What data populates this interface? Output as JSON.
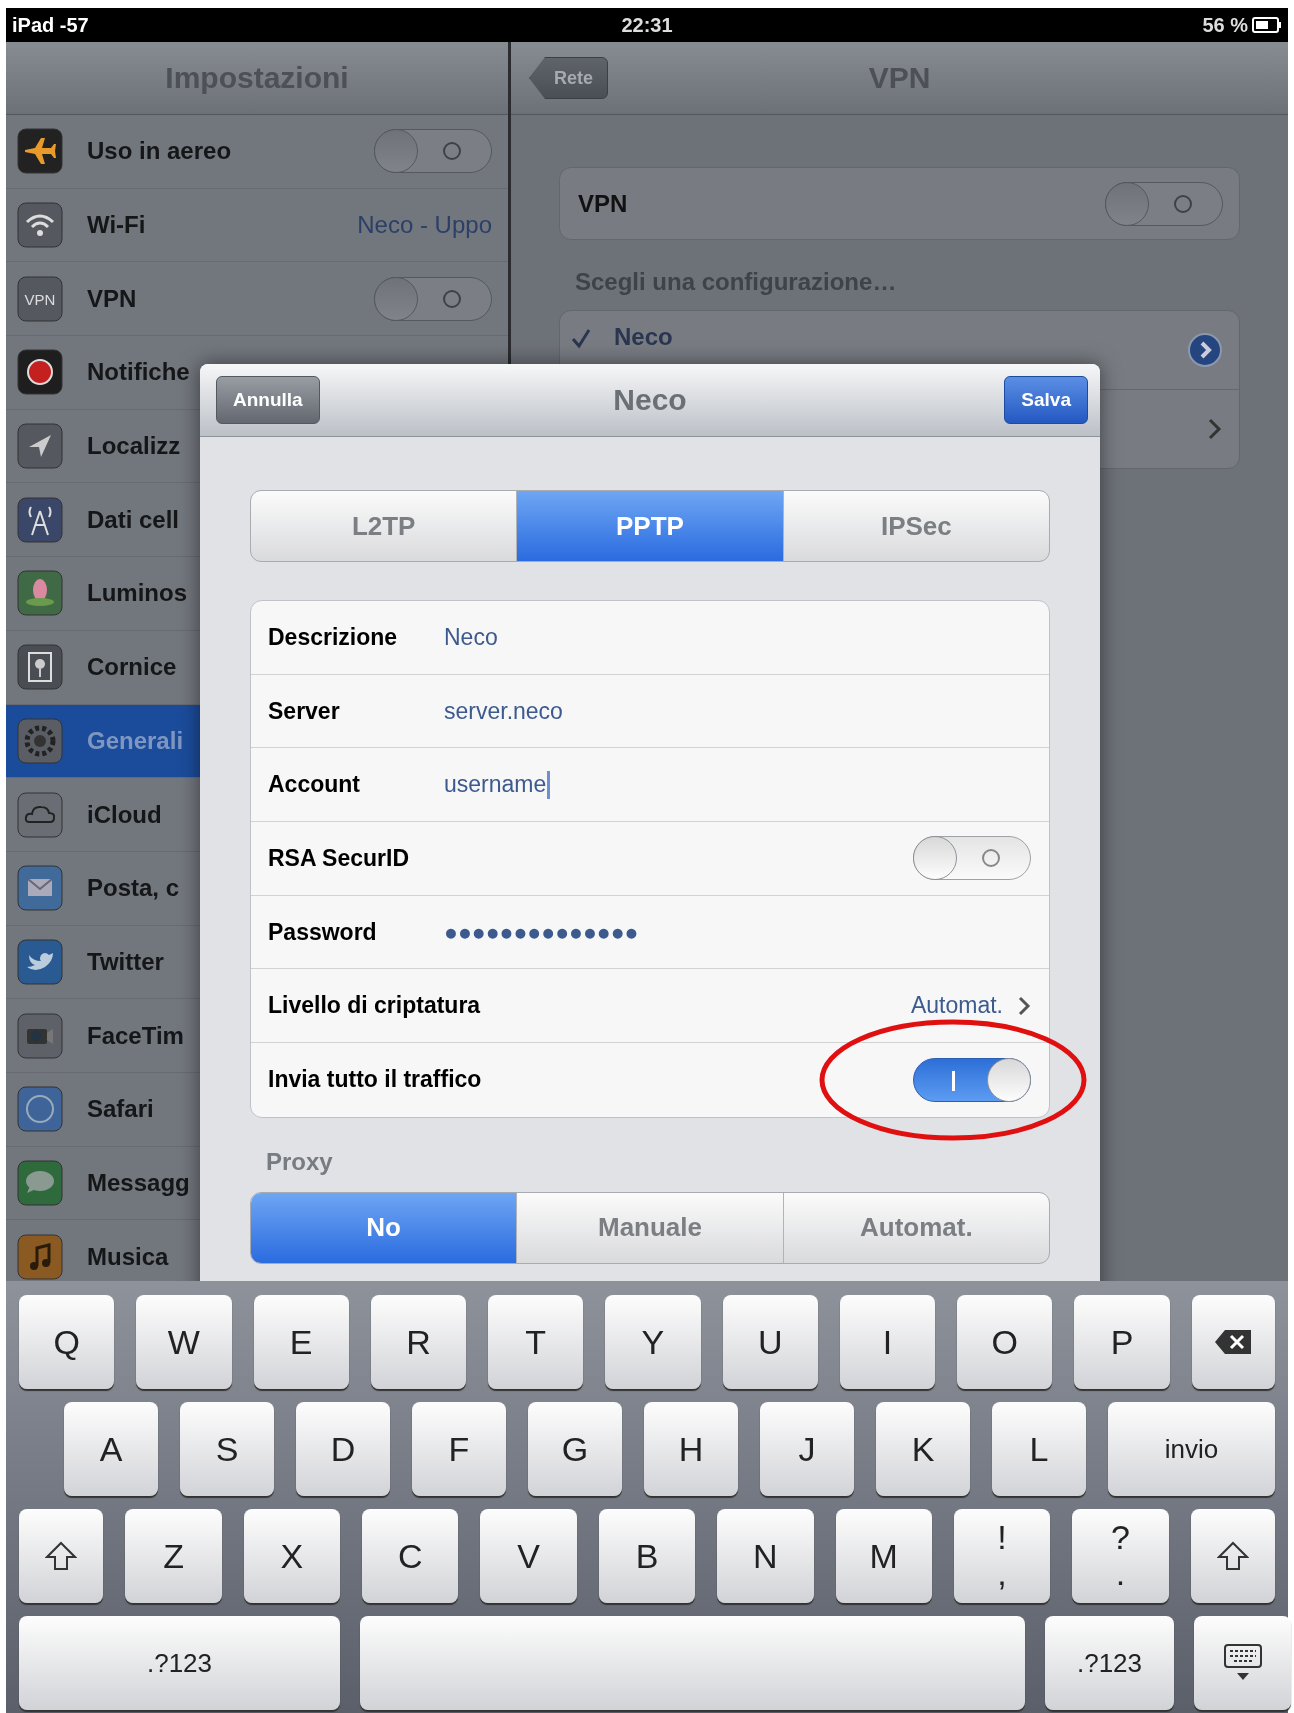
{
  "status_bar": {
    "carrier": "iPad -57",
    "time": "22:31",
    "battery": "56 %"
  },
  "sidebar": {
    "title": "Impostazioni",
    "items": [
      {
        "label": "Uso in aereo",
        "kind": "toggle",
        "on": false,
        "selected": false
      },
      {
        "label": "Wi-Fi",
        "kind": "value",
        "value": "Neco - Uppo",
        "selected": false
      },
      {
        "label": "VPN",
        "icon_text": "VPN",
        "kind": "toggle",
        "on": false,
        "selected": false
      },
      {
        "label": "Notifiche",
        "kind": "plain",
        "selected": false
      },
      {
        "label": "Localizz",
        "kind": "plain",
        "selected": false
      },
      {
        "label": "Dati cell",
        "kind": "plain",
        "selected": false
      },
      {
        "label": "Luminos",
        "kind": "plain",
        "selected": false
      },
      {
        "label": "Cornice",
        "kind": "plain",
        "selected": false
      },
      {
        "label": "Generali",
        "kind": "plain",
        "selected": true
      },
      {
        "label": "iCloud",
        "kind": "plain",
        "selected": false
      },
      {
        "label": "Posta, c",
        "kind": "plain",
        "selected": false
      },
      {
        "label": "Twitter",
        "kind": "plain",
        "selected": false
      },
      {
        "label": "FaceTim",
        "kind": "plain",
        "selected": false
      },
      {
        "label": "Safari",
        "kind": "plain",
        "selected": false
      },
      {
        "label": "Messagg",
        "kind": "plain",
        "selected": false
      },
      {
        "label": "Musica",
        "kind": "plain",
        "selected": false
      }
    ]
  },
  "detail": {
    "back_button": "Rete",
    "title": "VPN",
    "vpn_toggle": {
      "label": "VPN",
      "on": false
    },
    "section_title": "Scegli una configurazione…",
    "configurations": [
      {
        "name": "Neco",
        "selected": true
      },
      {
        "kind": "chevron"
      }
    ]
  },
  "modal": {
    "cancel": "Annulla",
    "title": "Neco",
    "save": "Salva",
    "types": [
      {
        "label": "L2TP",
        "selected": false
      },
      {
        "label": "PPTP",
        "selected": true
      },
      {
        "label": "IPSec",
        "selected": false
      }
    ],
    "fields": [
      {
        "kind": "text",
        "label": "Descrizione",
        "value": "Neco",
        "focused": false
      },
      {
        "kind": "text",
        "label": "Server",
        "value": "server.neco",
        "focused": false
      },
      {
        "kind": "text",
        "label": "Account",
        "value": "username",
        "focused": true
      },
      {
        "kind": "toggle",
        "label": "RSA SecurID",
        "on": false
      },
      {
        "kind": "text",
        "label": "Password",
        "value": "●●●●●●●●●●●●●●",
        "focused": false
      },
      {
        "kind": "link",
        "label": "Livello di criptatura",
        "value": "Automat."
      },
      {
        "kind": "toggle",
        "label": "Invia tutto il traffico",
        "on": true,
        "highlighted": true
      }
    ],
    "proxy_title": "Proxy",
    "proxy_options": [
      {
        "label": "No",
        "selected": true
      },
      {
        "label": "Manuale",
        "selected": false
      },
      {
        "label": "Automat.",
        "selected": false
      }
    ]
  },
  "keyboard": {
    "rows": [
      {
        "keys": [
          {
            "kind": "letter",
            "label": "Q"
          },
          {
            "kind": "letter",
            "label": "W"
          },
          {
            "kind": "letter",
            "label": "E"
          },
          {
            "kind": "letter",
            "label": "R"
          },
          {
            "kind": "letter",
            "label": "T"
          },
          {
            "kind": "letter",
            "label": "Y"
          },
          {
            "kind": "letter",
            "label": "U"
          },
          {
            "kind": "letter",
            "label": "I"
          },
          {
            "kind": "letter",
            "label": "O"
          },
          {
            "kind": "letter",
            "label": "P"
          },
          {
            "kind": "backspace"
          }
        ]
      },
      {
        "keys": [
          {
            "kind": "letter",
            "label": "A"
          },
          {
            "kind": "letter",
            "label": "S"
          },
          {
            "kind": "letter",
            "label": "D"
          },
          {
            "kind": "letter",
            "label": "F"
          },
          {
            "kind": "letter",
            "label": "G"
          },
          {
            "kind": "letter",
            "label": "H"
          },
          {
            "kind": "letter",
            "label": "J"
          },
          {
            "kind": "letter",
            "label": "K"
          },
          {
            "kind": "letter",
            "label": "L"
          },
          {
            "kind": "wide",
            "label": "invio"
          }
        ]
      },
      {
        "keys": [
          {
            "kind": "shift"
          },
          {
            "kind": "letter",
            "label": "Z"
          },
          {
            "kind": "letter",
            "label": "X"
          },
          {
            "kind": "letter",
            "label": "C"
          },
          {
            "kind": "letter",
            "label": "V"
          },
          {
            "kind": "letter",
            "label": "B"
          },
          {
            "kind": "letter",
            "label": "N"
          },
          {
            "kind": "letter",
            "label": "M"
          },
          {
            "kind": "dual",
            "top": "!",
            "bottom": ","
          },
          {
            "kind": "dual",
            "top": "?",
            "bottom": "."
          },
          {
            "kind": "shift"
          }
        ]
      },
      {
        "keys": [
          {
            "kind": "mode",
            "label": ".?123"
          },
          {
            "kind": "space"
          },
          {
            "kind": "mode",
            "label": ".?123"
          },
          {
            "kind": "hide"
          }
        ]
      }
    ]
  }
}
